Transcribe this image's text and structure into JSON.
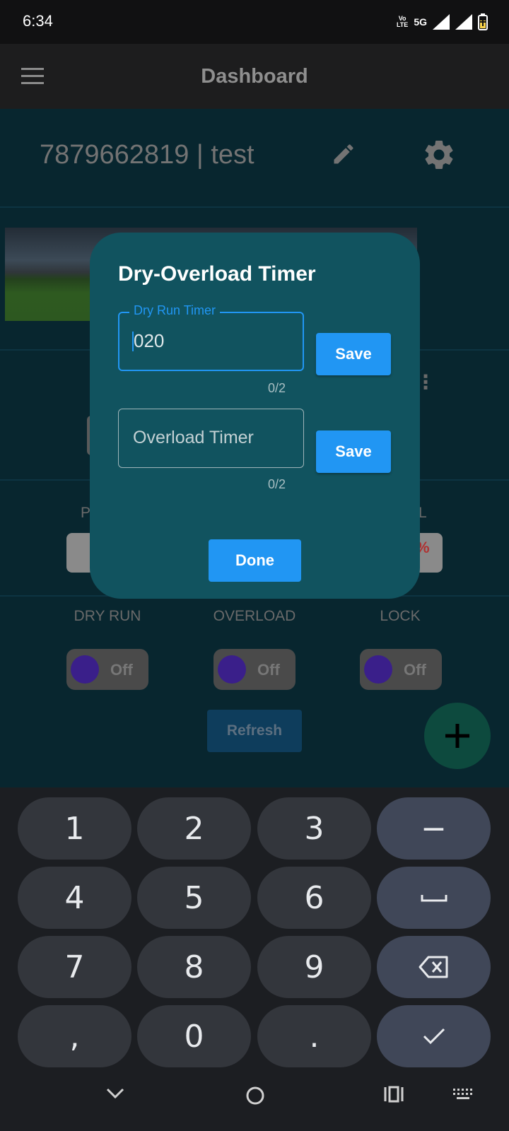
{
  "status_bar": {
    "time": "6:34",
    "volte_label": "Vo LTE",
    "network_label": "5G"
  },
  "app_bar": {
    "title": "Dashboard"
  },
  "device": {
    "title": "7879662819 | test"
  },
  "toggles_row": {
    "labels": [
      "DRY RUN",
      "OVERLOAD",
      "LOCK"
    ],
    "states": [
      "Off",
      "Off",
      "Off"
    ]
  },
  "partial_labels": {
    "left": "P",
    "right": "L"
  },
  "refresh_label": "Refresh",
  "dialog": {
    "title": "Dry-Overload Timer",
    "dry_run": {
      "label": "Dry Run Timer",
      "value": "020",
      "counter": "0/2",
      "save_label": "Save"
    },
    "overload": {
      "placeholder": "Overload Timer",
      "counter": "0/2",
      "save_label": "Save"
    },
    "done_label": "Done"
  },
  "keyboard": {
    "rows": [
      [
        "1",
        "2",
        "3",
        "−"
      ],
      [
        "4",
        "5",
        "6",
        "␣"
      ],
      [
        "7",
        "8",
        "9",
        "⌫"
      ],
      [
        ",",
        "0",
        ".",
        "✓"
      ]
    ]
  },
  "colors": {
    "accent": "#2196f3",
    "dialog_bg": "#11535f",
    "fab": "#0d4a3e"
  }
}
